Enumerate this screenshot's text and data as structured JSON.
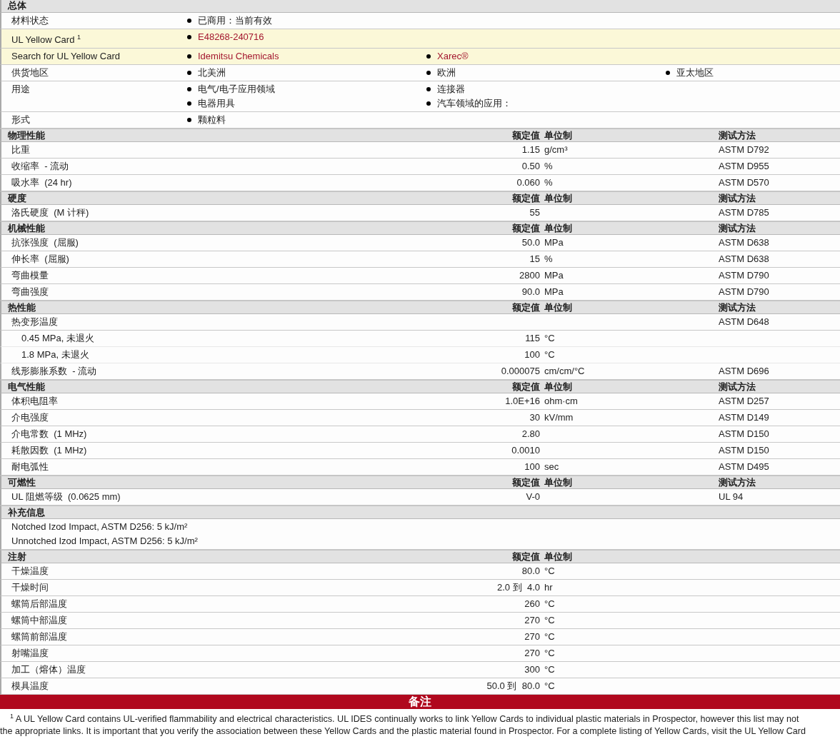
{
  "general": {
    "title": "总体",
    "rows": [
      {
        "label": "材料状态",
        "highlighted": false,
        "columns": [
          [
            {
              "text": "已商用：当前有效",
              "link": false
            }
          ]
        ]
      },
      {
        "label": "UL Yellow Card $^{1}$",
        "highlighted": true,
        "columns": [
          [
            {
              "text": "E48268-240716",
              "link": true
            }
          ]
        ]
      },
      {
        "label": "Search for UL Yellow Card",
        "highlighted": true,
        "columns": [
          [
            {
              "text": "Idemitsu Chemicals",
              "link": true
            }
          ],
          [
            {
              "text": "Xarec®",
              "link": true
            }
          ]
        ]
      },
      {
        "label": "供货地区",
        "highlighted": false,
        "columns": [
          [
            {
              "text": "北美洲",
              "link": false
            }
          ],
          [
            {
              "text": "欧洲",
              "link": false
            }
          ],
          [
            {
              "text": "亚太地区",
              "link": false
            }
          ]
        ]
      },
      {
        "label": "用途",
        "highlighted": false,
        "columns": [
          [
            {
              "text": "电气/电子应用领域",
              "link": false
            },
            {
              "text": "电器用具",
              "link": false
            }
          ],
          [
            {
              "text": "连接器",
              "link": false
            },
            {
              "text": "汽车领域的应用：",
              "link": false
            }
          ]
        ]
      },
      {
        "label": "形式",
        "highlighted": false,
        "columns": [
          [
            {
              "text": "颗粒料",
              "link": false
            }
          ]
        ]
      }
    ]
  },
  "sections": [
    {
      "kind": "properties",
      "title": "物理性能",
      "headers": {
        "value": "额定值",
        "unit": "单位制",
        "method": "测试方法"
      },
      "rows": [
        {
          "label": "比重",
          "value": "1.15",
          "unit": "g/cm³",
          "method": "ASTM D792"
        },
        {
          "label": "收缩率  - 流动",
          "value": "0.50",
          "unit": "%",
          "method": "ASTM D955"
        },
        {
          "label": "吸水率  (24 hr)",
          "value": "0.060",
          "unit": "%",
          "method": "ASTM D570"
        }
      ]
    },
    {
      "kind": "properties",
      "title": "硬度",
      "headers": {
        "value": "额定值",
        "unit": "单位制",
        "method": "测试方法"
      },
      "rows": [
        {
          "label": "洛氏硬度  (M 计秤)",
          "value": "55",
          "method": "ASTM D785"
        }
      ]
    },
    {
      "kind": "properties",
      "title": "机械性能",
      "headers": {
        "value": "额定值",
        "unit": "单位制",
        "method": "测试方法"
      },
      "rows": [
        {
          "label": "抗张强度  (屈服)",
          "value": "50.0",
          "unit": "MPa",
          "method": "ASTM D638"
        },
        {
          "label": "伸长率  (屈服)",
          "value": "15",
          "unit": "%",
          "method": "ASTM D638"
        },
        {
          "label": "弯曲模量",
          "value": "2800",
          "unit": "MPa",
          "method": "ASTM D790"
        },
        {
          "label": "弯曲强度",
          "value": "90.0",
          "unit": "MPa",
          "method": "ASTM D790"
        }
      ]
    },
    {
      "kind": "properties",
      "title": "热性能",
      "headers": {
        "value": "额定值",
        "unit": "单位制",
        "method": "测试方法"
      },
      "rows": [
        {
          "label": "热变形温度",
          "method": "ASTM D648",
          "children": [
            {
              "label": "0.45 MPa, 未退火",
              "value": "115",
              "unit": "°C"
            },
            {
              "label": "1.8 MPa, 未退火",
              "value": "100",
              "unit": "°C"
            }
          ]
        },
        {
          "label": "线形膨胀系数  - 流动",
          "value": "0.000075",
          "unit": "cm/cm/°C",
          "method": "ASTM D696"
        }
      ]
    },
    {
      "kind": "properties",
      "title": "电气性能",
      "headers": {
        "value": "额定值",
        "unit": "单位制",
        "method": "测试方法"
      },
      "rows": [
        {
          "label": "体积电阻率",
          "value": "1.0E+16",
          "unit": "ohm·cm",
          "method": "ASTM D257"
        },
        {
          "label": "介电强度",
          "value": "30",
          "unit": "kV/mm",
          "method": "ASTM D149"
        },
        {
          "label": "介电常数  (1 MHz)",
          "value": "2.80",
          "method": "ASTM D150"
        },
        {
          "label": "耗散因数  (1 MHz)",
          "value": "0.0010",
          "method": "ASTM D150"
        },
        {
          "label": "耐电弧性",
          "value": "100",
          "unit": "sec",
          "method": "ASTM D495"
        }
      ]
    },
    {
      "kind": "properties",
      "title": "可燃性",
      "headers": {
        "value": "额定值",
        "unit": "单位制",
        "method": "测试方法"
      },
      "rows": [
        {
          "label": "UL 阻燃等级  (0.0625 mm)",
          "value": "V-0",
          "method": "UL 94"
        }
      ]
    },
    {
      "kind": "notes",
      "title": "补充信息",
      "rows": [
        {
          "label": "Notched Izod Impact, ASTM D256: 5 kJ/m²"
        },
        {
          "label": "Unnotched Izod Impact, ASTM D256: 5 kJ/m²"
        }
      ]
    },
    {
      "kind": "properties",
      "title": "注射",
      "headers": {
        "value": "额定值",
        "unit": "单位制"
      },
      "rows": [
        {
          "label": "干燥温度",
          "value": "80.0",
          "unit": "°C"
        },
        {
          "label": "干燥时间",
          "value": "2.0 到  4.0",
          "unit": "hr"
        },
        {
          "label": "螺筒后部温度",
          "value": "260",
          "unit": "°C"
        },
        {
          "label": "螺筒中部温度",
          "value": "270",
          "unit": "°C"
        },
        {
          "label": "螺筒前部温度",
          "value": "270",
          "unit": "°C"
        },
        {
          "label": "射嘴温度",
          "value": "270",
          "unit": "°C"
        },
        {
          "label": "加工（熔体）温度",
          "value": "300",
          "unit": "°C"
        },
        {
          "label": "模具温度",
          "value": "50.0 到  80.0",
          "unit": "°C"
        }
      ]
    }
  ],
  "remarks": {
    "title": "备注",
    "lines": [
      "$^{1}$ A UL Yellow Card contains UL-verified flammability and electrical characteristics. UL IDES continually works to link Yellow Cards to individual plastic materials in Prospector, however this list may not",
      "the appropriate links. It is important that you verify the association between these Yellow Cards and the plastic material found in Prospector. For a complete listing of Yellow Cards, visit the UL Yellow Card"
    ]
  }
}
